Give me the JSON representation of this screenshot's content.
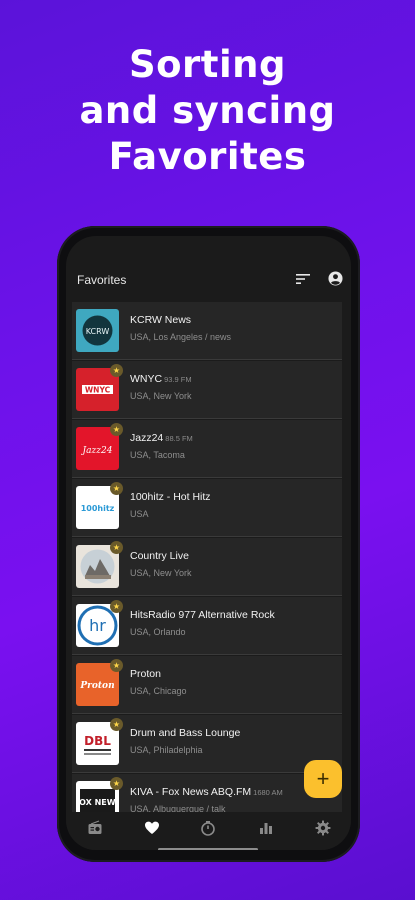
{
  "headline": {
    "line1": "Sorting",
    "line2": "and syncing",
    "line3": "Favorites"
  },
  "appbar": {
    "title": "Favorites",
    "sort_icon": "sort-icon",
    "account_icon": "account-icon"
  },
  "stations": [
    {
      "name": "KCRW News",
      "freq": "",
      "sub": "USA, Los Angeles / news",
      "logo_text": "KCRW",
      "favorite": false
    },
    {
      "name": "WNYC",
      "freq": "93.9 FM",
      "sub": "USA, New York",
      "logo_text": "WNYC",
      "favorite": true
    },
    {
      "name": "Jazz24",
      "freq": "88.5 FM",
      "sub": "USA, Tacoma",
      "logo_text": "Jazz24",
      "favorite": true
    },
    {
      "name": "100hitz - Hot Hitz",
      "freq": "",
      "sub": "USA",
      "logo_text": "100hitz",
      "favorite": true
    },
    {
      "name": "Country Live",
      "freq": "",
      "sub": "USA, New York",
      "logo_text": "",
      "favorite": true
    },
    {
      "name": "HitsRadio 977 Alternative Rock",
      "freq": "",
      "sub": "USA, Orlando",
      "logo_text": "hr",
      "favorite": true
    },
    {
      "name": "Proton",
      "freq": "",
      "sub": "USA, Chicago",
      "logo_text": "Proton",
      "favorite": true
    },
    {
      "name": "Drum and Bass Lounge",
      "freq": "",
      "sub": "USA, Philadelphia",
      "logo_text": "DBL",
      "favorite": true
    },
    {
      "name": "KIVA - Fox News ABQ.FM",
      "freq": "1680 AM",
      "sub": "USA, Albuquerque / talk",
      "logo_text": "FOX NEWS",
      "favorite": true
    }
  ],
  "fab": {
    "label": "+"
  },
  "bottom_nav": [
    {
      "icon": "radio-icon",
      "active": false
    },
    {
      "icon": "heart-icon",
      "active": true
    },
    {
      "icon": "timer-icon",
      "active": false
    },
    {
      "icon": "chart-icon",
      "active": false
    },
    {
      "icon": "gear-icon",
      "active": false
    }
  ],
  "colors": {
    "background": "#6d12ea",
    "accent": "#fbc02d",
    "surface": "#262626"
  }
}
